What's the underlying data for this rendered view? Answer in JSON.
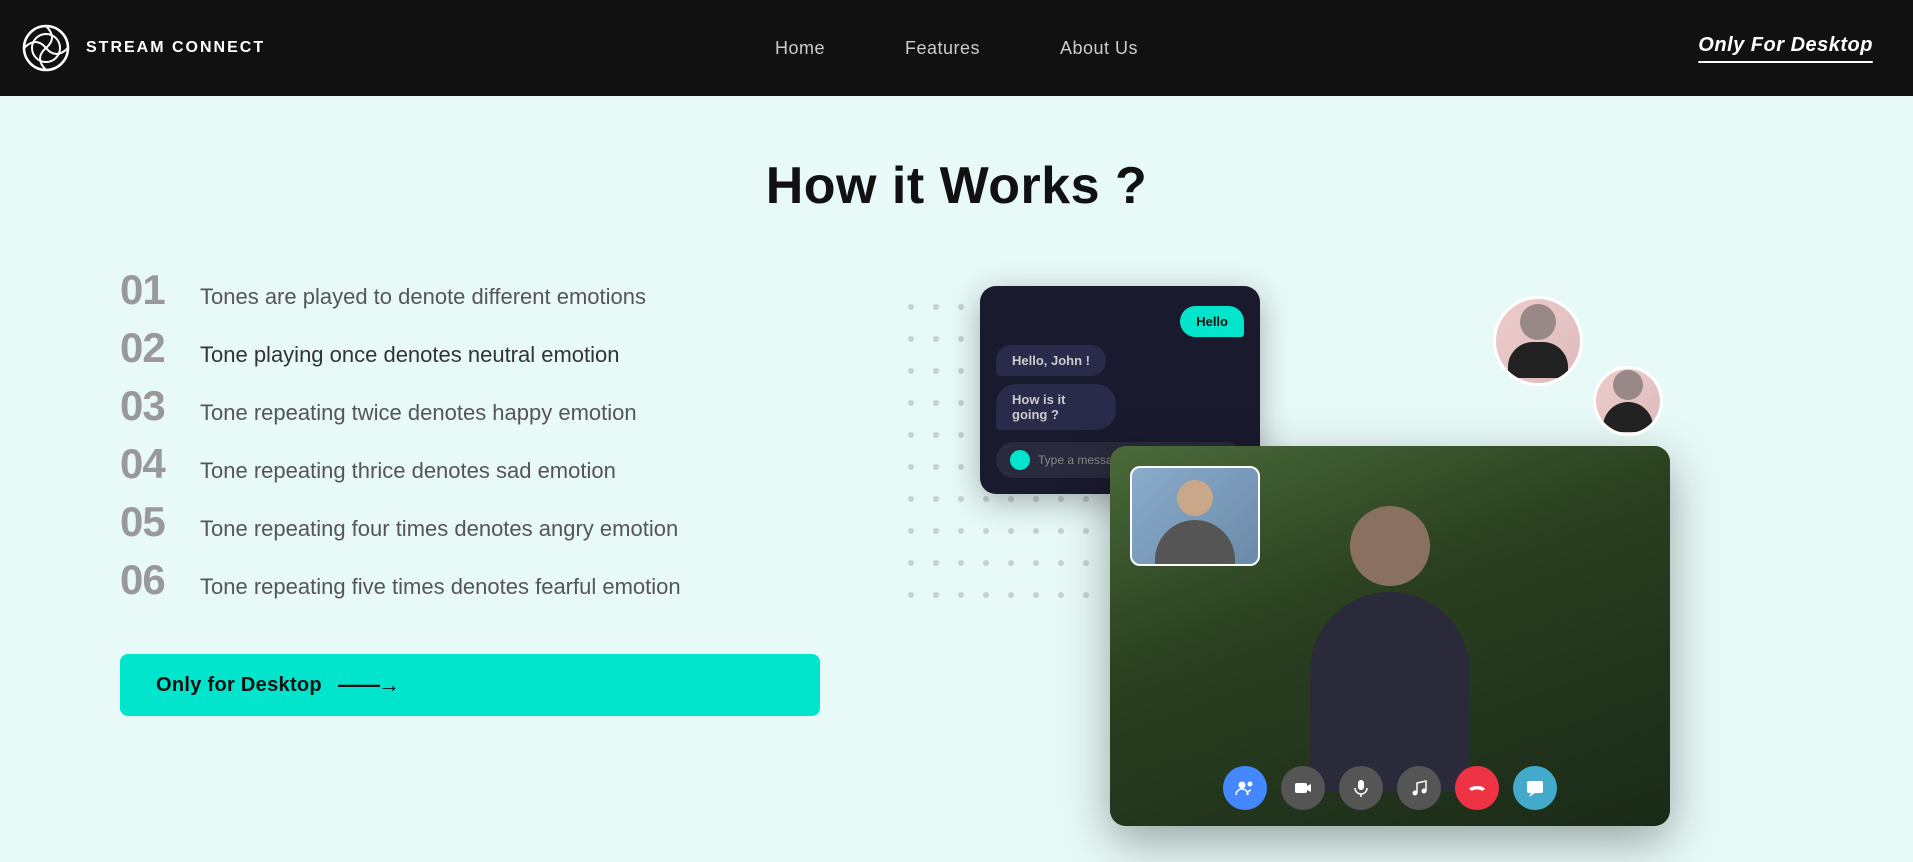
{
  "nav": {
    "logo_text": "STREAM CONNECT",
    "links": [
      "Home",
      "Features",
      "About Us"
    ],
    "right_label": "Only For Desktop"
  },
  "main": {
    "section_title": "How it Works ?",
    "steps": [
      {
        "number": "01",
        "text": "Tones are played to denote different emotions",
        "active": false
      },
      {
        "number": "02",
        "text": "Tone playing once denotes neutral emotion",
        "active": true
      },
      {
        "number": "03",
        "text": "Tone repeating twice denotes happy emotion",
        "active": false
      },
      {
        "number": "04",
        "text": "Tone repeating thrice denotes sad emotion",
        "active": false
      },
      {
        "number": "05",
        "text": "Tone repeating four times denotes angry emotion",
        "active": false
      },
      {
        "number": "06",
        "text": "Tone repeating five times denotes fearful emotion",
        "active": false
      }
    ],
    "cta_button": "Only for Desktop",
    "cta_arrow": "——→",
    "chat": {
      "bubble1": "Hello",
      "bubble2": "Hello, John !",
      "bubble3": "How is it going ?",
      "input_placeholder": "Type a message..."
    }
  }
}
